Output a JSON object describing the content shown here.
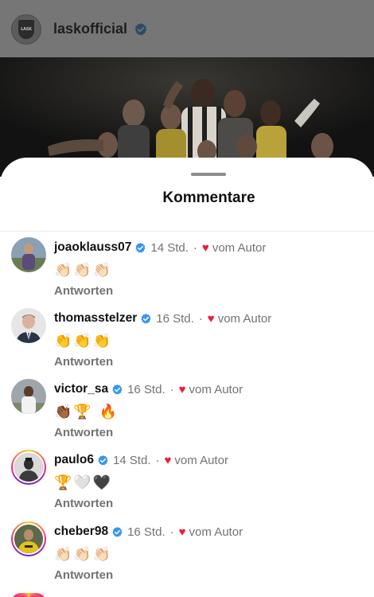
{
  "post": {
    "username": "laskofficial",
    "logo_text": "LASK",
    "verified_icon": "verified-badge-icon"
  },
  "sheet": {
    "title": "Kommentare"
  },
  "comments": [
    {
      "username": "joaoklauss07",
      "time": "14 Std.",
      "separator": "·",
      "heart": "♥",
      "liked_by": "vom Autor",
      "text": "👏🏻👏🏻👏🏻",
      "reply": "Antworten",
      "avatar_color": "#6b5a7d",
      "story_ring": false
    },
    {
      "username": "thomasstelzer",
      "time": "16 Std.",
      "separator": "·",
      "heart": "♥",
      "liked_by": "vom Autor",
      "text": "👏👏👏",
      "reply": "Antworten",
      "avatar_color": "#b9a79a",
      "story_ring": false
    },
    {
      "username": "victor_sa",
      "time": "16 Std.",
      "separator": "·",
      "heart": "♥",
      "liked_by": "vom Autor",
      "text": "👏🏾🏆 🔥",
      "reply": "Antworten",
      "avatar_color": "#8a8f96",
      "story_ring": false
    },
    {
      "username": "paulo6",
      "time": "14 Std.",
      "separator": "·",
      "heart": "♥",
      "liked_by": "vom Autor",
      "text": "🏆🤍🖤",
      "reply": "Antworten",
      "avatar_color": "#3a3a3a",
      "story_ring": true
    },
    {
      "username": "cheber98",
      "time": "16 Std.",
      "separator": "·",
      "heart": "♥",
      "liked_by": "vom Autor",
      "text": "👏🏻👏🏻👏🏻",
      "reply": "Antworten",
      "avatar_color": "#c9a227",
      "story_ring": true
    }
  ],
  "colors": {
    "verified": "#3897f0",
    "heart": "#ed1c3a",
    "secondary_text": "#737373"
  }
}
